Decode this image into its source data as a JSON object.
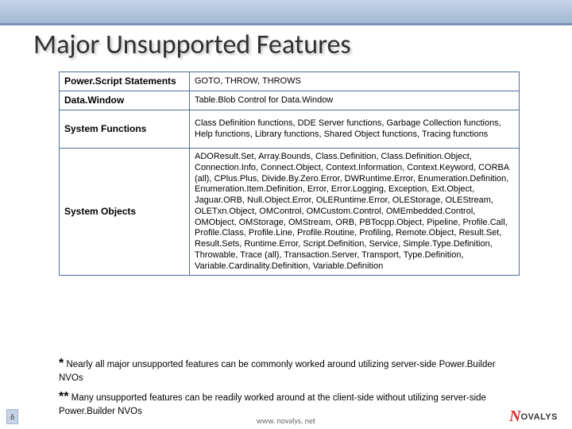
{
  "title": "Major Unsupported Features",
  "table": {
    "rows": [
      {
        "label": "Power.Script Statements",
        "value": "GOTO, THROW, THROWS"
      },
      {
        "label": "Data.Window",
        "value": "Table.Blob Control for Data.Window"
      },
      {
        "label": "System Functions",
        "value": "Class Definition functions, DDE Server functions, Garbage Collection functions, Help functions, Library functions, Shared Object functions, Tracing functions"
      },
      {
        "label": "System Objects",
        "value": "ADOResult.Set, Array.Bounds, Class.Definition, Class.Definition.Object, Connection.Info, Connect.Object, Context.Information, Context.Keyword, CORBA (all), CPlus.Plus, Divide.By.Zero.Error, DWRuntime.Error, Enumeration.Definition, Enumeration.Item.Definition, Error, Error.Logging, Exception, Ext.Object, Jaguar.ORB, Null.Object.Error, OLERuntime.Error, OLEStorage, OLEStream, OLETxn.Object, OMControl, OMCustom.Control, OMEmbedded.Control, OMObject, OMStorage, OMStream, ORB, PBTocpp.Object, Pipeline, Profile.Call, Profile.Class, Profile.Line, Profile.Routine, Profiling, Remote.Object, Result.Set, Result.Sets, Runtime.Error, Script.Definition, Service, Simple.Type.Definition, Throwable, Trace (all), Transaction.Server, Transport, Type.Definition, Variable.Cardinality.Definition, Variable.Definition"
      }
    ]
  },
  "notes": {
    "n1": {
      "star": "*",
      "text": "Nearly all major unsupported features can be commonly worked around utilizing server-side Power.Builder NVOs"
    },
    "n2": {
      "star": "**",
      "text": "Many unsupported features can be readily worked around at the client-side without utilizing server-side Power.Builder NVOs"
    }
  },
  "page_number": "6",
  "footer_url": "www. novalys. net",
  "logo": {
    "mark": "N",
    "text": "OVALYS"
  }
}
